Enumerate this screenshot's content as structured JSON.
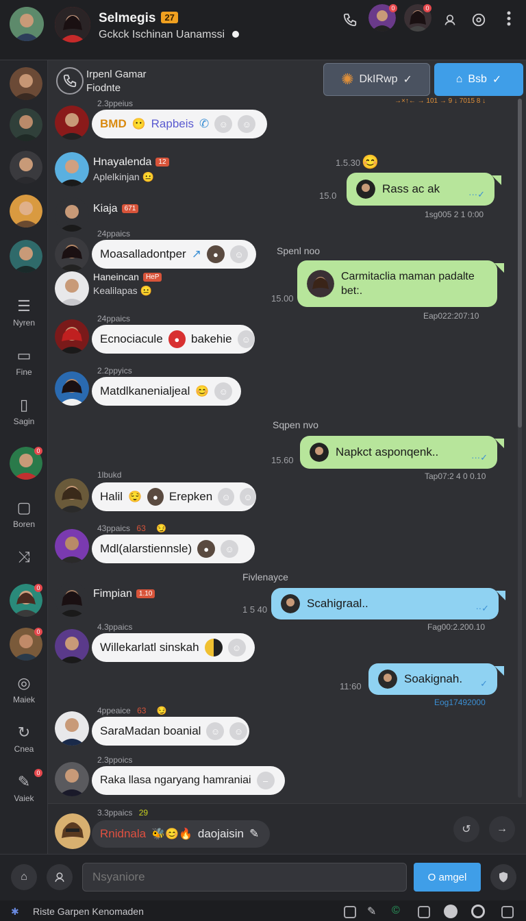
{
  "header": {
    "title": "Selmegis",
    "title_badge": "27",
    "subtitle": "Gckck Ischinan Uanamssi",
    "contact_badges": [
      "0",
      "0"
    ]
  },
  "sidebar": {
    "nav": [
      {
        "label": "Nyren",
        "icon": "message-icon"
      },
      {
        "label": "Fine",
        "icon": "file-icon"
      },
      {
        "label": "Sagin",
        "icon": "phone-icon"
      },
      {
        "label": "Boren",
        "icon": "chat-icon"
      },
      {
        "label": "Maiek",
        "icon": "camera-icon"
      },
      {
        "label": "Cnea",
        "icon": "refresh-icon"
      },
      {
        "label": "Vaiek",
        "icon": "pen-icon"
      }
    ],
    "avatar_badges": [
      "0",
      "0",
      "0",
      "0",
      "0"
    ]
  },
  "chat": {
    "pinned": {
      "line1": "Irpenl Gamar",
      "line2": "Fiodnte"
    },
    "top_buttons": [
      {
        "label": "DkIRwp"
      },
      {
        "label": "Bsb"
      }
    ],
    "top_note": "→×↑← → 101 → 9 ↓ 7015 8 ↓",
    "incoming": [
      {
        "meta": "2.3ppeius",
        "text": "BMD",
        "text2": "Rapbeis"
      },
      {
        "name": "Hnayalenda",
        "badge": "12",
        "sub": "Aplelkinjan"
      },
      {
        "name": "Kiaja",
        "badge": "671"
      },
      {
        "meta": "24ppaics",
        "text": "Moasalladontper"
      },
      {
        "name": "Haneincan",
        "badge": "HeP",
        "sub": "Kealilapas"
      },
      {
        "meta": "24ppaics",
        "text": "Ecnociacule",
        "text2": "bakehie"
      },
      {
        "meta": "2.2ppyics",
        "text": "Matdlkanenialjeal"
      },
      {
        "meta": "1lbukd",
        "text": "Halil",
        "text2": "Erepken"
      },
      {
        "meta": "43ppaics",
        "badge": "63",
        "text": "Mdl(alarstiennsle)"
      },
      {
        "name": "Fimpian",
        "badge": "1.10"
      },
      {
        "meta": "4.3ppaics",
        "text": "Willekarlatl sinskah"
      },
      {
        "meta": "4ppeaice",
        "badge": "63",
        "text": "SaraMadan boanial"
      },
      {
        "meta": "2.3ppoics",
        "text": "Raka llasa ngaryang hamraniai"
      }
    ],
    "outgoing": [
      {
        "time_above": "1.5.30",
        "time": "15.0",
        "text": "Rass ac ak",
        "stamp": "1sg005 2 1 0:00",
        "color": "green"
      },
      {
        "label": "Spenl noo",
        "time": "15.00",
        "text": "Carmitaclia maman padalte bet:.",
        "stamp": "Eap022:207:10",
        "color": "green"
      },
      {
        "label": "Sqpen nvo",
        "time": "15.60",
        "text": "Napkct asponqenk..",
        "stamp": "Tap07:2 4 0 0.10",
        "color": "green"
      },
      {
        "label": "Fivlenayce",
        "time": "1 5 40",
        "text": "Scahigraal..",
        "stamp": "Fag00:2.200.10",
        "color": "blue"
      },
      {
        "time": "11:60",
        "text": "Soakignah.",
        "stamp": "Eog17492000",
        "color": "blue"
      }
    ]
  },
  "composer": {
    "meta": "3.3ppaics",
    "meta_badge": "29",
    "name": "Rnidnala",
    "action": "daojaisin"
  },
  "input": {
    "placeholder": "Nsyaniore",
    "send_label": "O amgel"
  },
  "status": {
    "text": "Riste Garpen Kenomaden"
  },
  "colors": {
    "accent": "#3f9ee8",
    "outgoing_green": "#b7e59b",
    "outgoing_blue": "#8fd2f2",
    "badge_red": "#e5484d",
    "title_badge": "#f0a020"
  }
}
